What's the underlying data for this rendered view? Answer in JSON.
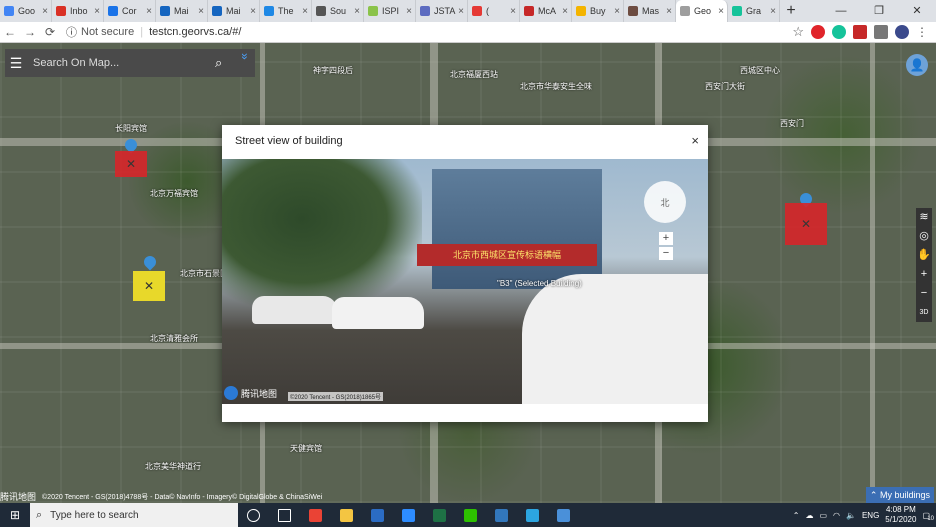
{
  "browser": {
    "tabs": [
      {
        "label": "Goo",
        "color": "#4285f4",
        "active": false
      },
      {
        "label": "Inbo",
        "color": "#d93025",
        "active": false
      },
      {
        "label": "Cor",
        "color": "#1a73e8",
        "active": false
      },
      {
        "label": "Mai",
        "color": "#1565c0",
        "active": false
      },
      {
        "label": "Mai",
        "color": "#1565c0",
        "active": false
      },
      {
        "label": "The",
        "color": "#1e88e5",
        "active": false
      },
      {
        "label": "Sou",
        "color": "#555555",
        "active": false
      },
      {
        "label": "ISPI",
        "color": "#8bc34a",
        "active": false
      },
      {
        "label": "JSTA",
        "color": "#5c6bc0",
        "active": false
      },
      {
        "label": "(",
        "color": "#e53935",
        "active": false
      },
      {
        "label": "McA",
        "color": "#c62828",
        "active": false
      },
      {
        "label": "Buy",
        "color": "#f4b400",
        "active": false
      },
      {
        "label": "Mas",
        "color": "#6d4c41",
        "active": false
      },
      {
        "label": "Geo",
        "color": "#9e9e9e",
        "active": true
      },
      {
        "label": "Gra",
        "color": "#15c39a",
        "active": false
      }
    ],
    "tab_close": "×",
    "new_tab": "+",
    "window_controls": {
      "minimize": "—",
      "restore": "❐",
      "close": "✕"
    },
    "nav": {
      "back": "←",
      "forward": "→",
      "reload": "⟳"
    },
    "security": "Not secure",
    "url": "testcn.georvs.ca/#/",
    "star": "☆"
  },
  "map": {
    "search_placeholder": "Search On Map...",
    "menu_icon": "☰",
    "search_icon": "⌕",
    "expand_icon": "»",
    "labels": [
      {
        "text": "神字四段后"
      },
      {
        "text": "北京福厦西站"
      },
      {
        "text": "北京市华泰安生全味"
      },
      {
        "text": "西城区中心"
      },
      {
        "text": "西安门大街"
      },
      {
        "text": "长阳宾馆"
      },
      {
        "text": "北京市石景区"
      },
      {
        "text": "北京万福宾馆"
      },
      {
        "text": "北京清雅会所"
      },
      {
        "text": "天健宾馆"
      },
      {
        "text": "北京美华神道行"
      },
      {
        "text": "西安门"
      }
    ],
    "buildings": [
      {
        "id": "red-north",
        "color": "#d7262a",
        "mark": "✕"
      },
      {
        "id": "yellow",
        "color": "#e8d82a",
        "mark": "✕"
      },
      {
        "id": "red-east",
        "color": "#d7262a",
        "mark": "✕"
      }
    ],
    "right_controls": [
      "≋",
      "◎",
      "✋",
      "+",
      "−",
      "3D"
    ],
    "copyright": "©2020 Tencent - GS(2018)4788号 - Data© NavInfo - Imagery© DigitalGlobe & ChinaSiWei",
    "logo_text": "腾讯地图",
    "my_buildings": "⌃ My buildings"
  },
  "modal": {
    "title": "Street view of building",
    "close": "×",
    "selected_label": "\"B3\" (Selected Building)",
    "banner_text": "北京市西城区宣传标语横幅",
    "compass_label": "北",
    "zoom_in": "+",
    "zoom_out": "−",
    "logo_text": "腾讯地图",
    "copyright": "©2020 Tencent - GS(2018)1865号"
  },
  "taskbar": {
    "start_icon": "⊞",
    "search_placeholder": "Type here to search",
    "search_icon": "○",
    "apps": [
      {
        "name": "cortana",
        "color": "#ffffff"
      },
      {
        "name": "task-view",
        "color": "#ffffff"
      },
      {
        "name": "chrome",
        "color": "#ea4335"
      },
      {
        "name": "file-explorer",
        "color": "#f4c542"
      },
      {
        "name": "visual-studio",
        "color": "#2b6cc4"
      },
      {
        "name": "zoom",
        "color": "#2d8cff"
      },
      {
        "name": "excel",
        "color": "#1e7145"
      },
      {
        "name": "wechat",
        "color": "#2dc100"
      },
      {
        "name": "edge",
        "color": "#3277bc"
      },
      {
        "name": "telegram",
        "color": "#2ca5e0"
      },
      {
        "name": "paint",
        "color": "#4a90d9"
      }
    ],
    "lang": "ENG",
    "time": "4:08 PM",
    "date": "5/1/2020",
    "notifications": "10"
  }
}
